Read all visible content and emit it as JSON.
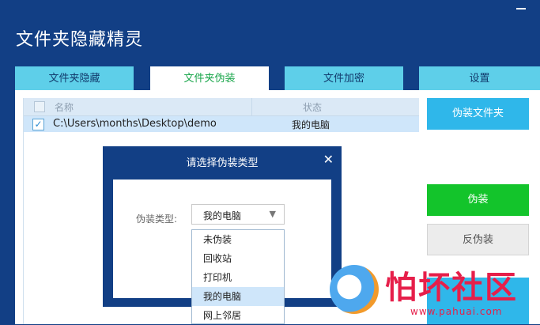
{
  "app": {
    "title": "文件夹隐藏精灵"
  },
  "tabs": [
    {
      "label": "文件夹隐藏",
      "active": false
    },
    {
      "label": "文件夹伪装",
      "active": true
    },
    {
      "label": "文件加密",
      "active": false
    },
    {
      "label": "设置",
      "active": false
    }
  ],
  "file_list": {
    "columns": [
      "名称",
      "状态"
    ],
    "rows": [
      {
        "checked": true,
        "path": "C:\\Users\\months\\Desktop\\demo",
        "status": "我的电脑"
      }
    ]
  },
  "buttons": {
    "disguise_folder": "伪装文件夹",
    "disguise": "伪装",
    "undisguise": "反伪装"
  },
  "dialog": {
    "title": "请选择伪装类型",
    "type_label": "伪装类型:",
    "selected_value": "我的电脑",
    "options": [
      "未伪装",
      "回收站",
      "打印机",
      "我的电脑",
      "网上邻居"
    ]
  },
  "watermark": {
    "text": "怕坏社区",
    "url": "www.pahuai.com"
  },
  "colors": {
    "window_bg": "#123f85",
    "tab_bg": "#5ecfe9",
    "tab_active_text": "#1aa64b",
    "primary_button": "#2fb7ea",
    "green_button": "#13c42b",
    "selected_row": "#cfe6fa",
    "watermark": "#e61f4a"
  },
  "icons": {
    "close": "close-icon",
    "dropdown_arrow": "triangle-down-icon",
    "checkbox": "check-icon"
  }
}
